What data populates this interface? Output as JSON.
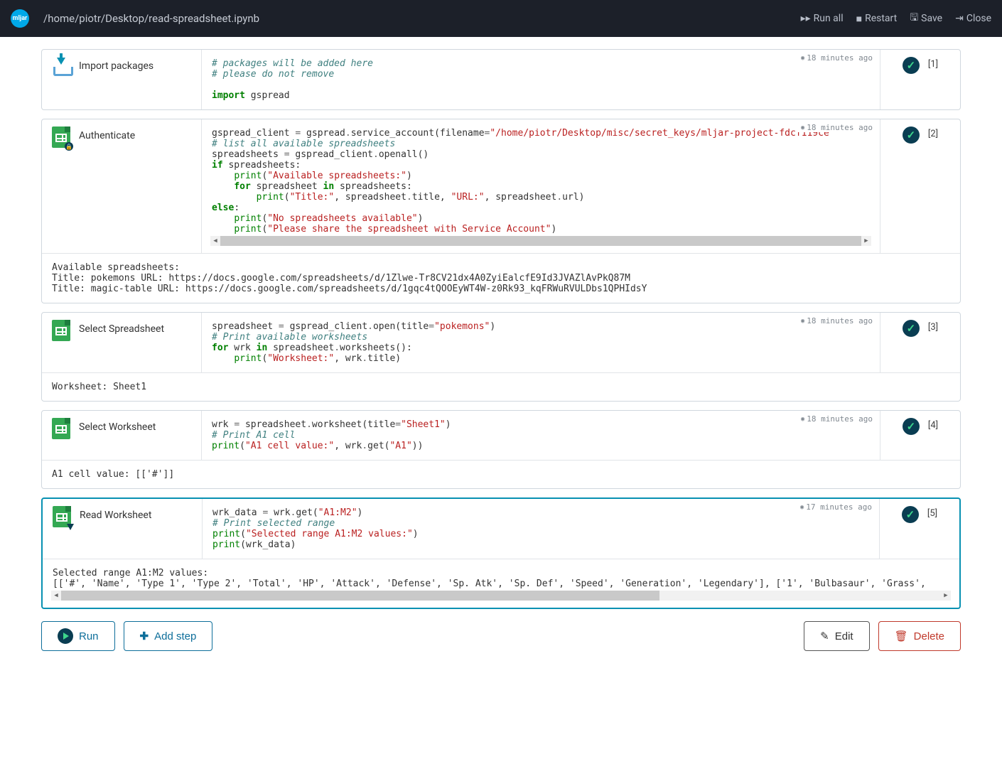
{
  "header": {
    "logo_text": "mljar",
    "filepath": "/home/piotr/Desktop/read-spreadsheet.ipynb",
    "run_all": "Run all",
    "restart": "Restart",
    "save": "Save",
    "close": "Close"
  },
  "cells": [
    {
      "title": "Import packages",
      "time": "18 minutes ago",
      "exec": "[1]",
      "output": null
    },
    {
      "title": "Authenticate",
      "time": "18 minutes ago",
      "exec": "[2]",
      "output": "Available spreadsheets:\nTitle: pokemons URL: https://docs.google.com/spreadsheets/d/1Zlwe-Tr8CV21dx4A0ZyiEalcfE9Id3JVAZlAvPkQ87M\nTitle: magic-table URL: https://docs.google.com/spreadsheets/d/1gqc4tQOOEyWT4W-z0Rk93_kqFRWuRVULDbs1QPHIdsY"
    },
    {
      "title": "Select Spreadsheet",
      "time": "18 minutes ago",
      "exec": "[3]",
      "output": "Worksheet: Sheet1"
    },
    {
      "title": "Select Worksheet",
      "time": "18 minutes ago",
      "exec": "[4]",
      "output": "A1 cell value: [['#']]"
    },
    {
      "title": "Read Worksheet",
      "time": "17 minutes ago",
      "exec": "[5]",
      "output": "Selected range A1:M2 values:\n[['#', 'Name', 'Type 1', 'Type 2', 'Total', 'HP', 'Attack', 'Defense', 'Sp. Atk', 'Sp. Def', 'Speed', 'Generation', 'Legendary'], ['1', 'Bulbasaur', 'Grass', "
    }
  ],
  "footer": {
    "run": "Run",
    "add_step": "Add step",
    "edit": "Edit",
    "delete": "Delete"
  },
  "code": {
    "c1_l1": "# packages will be added here",
    "c1_l2": "# please do not remove",
    "c1_l3_a": "import",
    "c1_l3_b": " gspread",
    "c2_l1_a": "gspread_client ",
    "c2_l1_b": "=",
    "c2_l1_c": " gspread",
    "c2_l1_d": ".",
    "c2_l1_e": "service_account(filename",
    "c2_l1_f": "=",
    "c2_l1_g": "\"/home/piotr/Desktop/misc/secret_keys/mljar-project-fdcf119ce",
    "c2_l2": "# list all available spreadsheets",
    "c2_l3_a": "spreadsheets ",
    "c2_l3_b": "=",
    "c2_l3_c": " gspread_client",
    "c2_l3_d": ".",
    "c2_l3_e": "openall()",
    "c2_l4_a": "if",
    "c2_l4_b": " spreadsheets:",
    "c2_l5_a": "    ",
    "c2_l5_b": "print",
    "c2_l5_c": "(",
    "c2_l5_d": "\"Available spreadsheets:\"",
    "c2_l5_e": ")",
    "c2_l6_a": "    ",
    "c2_l6_b": "for",
    "c2_l6_c": " spreadsheet ",
    "c2_l6_d": "in",
    "c2_l6_e": " spreadsheets:",
    "c2_l7_a": "        ",
    "c2_l7_b": "print",
    "c2_l7_c": "(",
    "c2_l7_d": "\"Title:\"",
    "c2_l7_e": ", spreadsheet",
    "c2_l7_f": ".",
    "c2_l7_g": "title, ",
    "c2_l7_h": "\"URL:\"",
    "c2_l7_i": ", spreadsheet",
    "c2_l7_j": ".",
    "c2_l7_k": "url)",
    "c2_l8_a": "else",
    "c2_l8_b": ":",
    "c2_l9_a": "    ",
    "c2_l9_b": "print",
    "c2_l9_c": "(",
    "c2_l9_d": "\"No spreadsheets available\"",
    "c2_l9_e": ")",
    "c2_l10_a": "    ",
    "c2_l10_b": "print",
    "c2_l10_c": "(",
    "c2_l10_d": "\"Please share the spreadsheet with Service Account\"",
    "c2_l10_e": ")",
    "c3_l1_a": "spreadsheet ",
    "c3_l1_b": "=",
    "c3_l1_c": " gspread_client",
    "c3_l1_d": ".",
    "c3_l1_e": "open(title",
    "c3_l1_f": "=",
    "c3_l1_g": "\"pokemons\"",
    "c3_l1_h": ")",
    "c3_l2": "# Print available worksheets",
    "c3_l3_a": "for",
    "c3_l3_b": " wrk ",
    "c3_l3_c": "in",
    "c3_l3_d": " spreadsheet",
    "c3_l3_e": ".",
    "c3_l3_f": "worksheets():",
    "c3_l4_a": "    ",
    "c3_l4_b": "print",
    "c3_l4_c": "(",
    "c3_l4_d": "\"Worksheet:\"",
    "c3_l4_e": ", wrk",
    "c3_l4_f": ".",
    "c3_l4_g": "title)",
    "c4_l1_a": "wrk ",
    "c4_l1_b": "=",
    "c4_l1_c": " spreadsheet",
    "c4_l1_d": ".",
    "c4_l1_e": "worksheet(title",
    "c4_l1_f": "=",
    "c4_l1_g": "\"Sheet1\"",
    "c4_l1_h": ")",
    "c4_l2": "# Print A1 cell",
    "c4_l3_a": "print",
    "c4_l3_b": "(",
    "c4_l3_c": "\"A1 cell value:\"",
    "c4_l3_d": ", wrk",
    "c4_l3_e": ".",
    "c4_l3_f": "get(",
    "c4_l3_g": "\"A1\"",
    "c4_l3_h": "))",
    "c5_l1_a": "wrk_data ",
    "c5_l1_b": "=",
    "c5_l1_c": " wrk",
    "c5_l1_d": ".",
    "c5_l1_e": "get(",
    "c5_l1_f": "\"A1:M2\"",
    "c5_l1_g": ")",
    "c5_l2": "# Print selected range",
    "c5_l3_a": "print",
    "c5_l3_b": "(",
    "c5_l3_c": "\"Selected range A1:M2 values:\"",
    "c5_l3_d": ")",
    "c5_l4_a": "print",
    "c5_l4_b": "(wrk_data)"
  }
}
